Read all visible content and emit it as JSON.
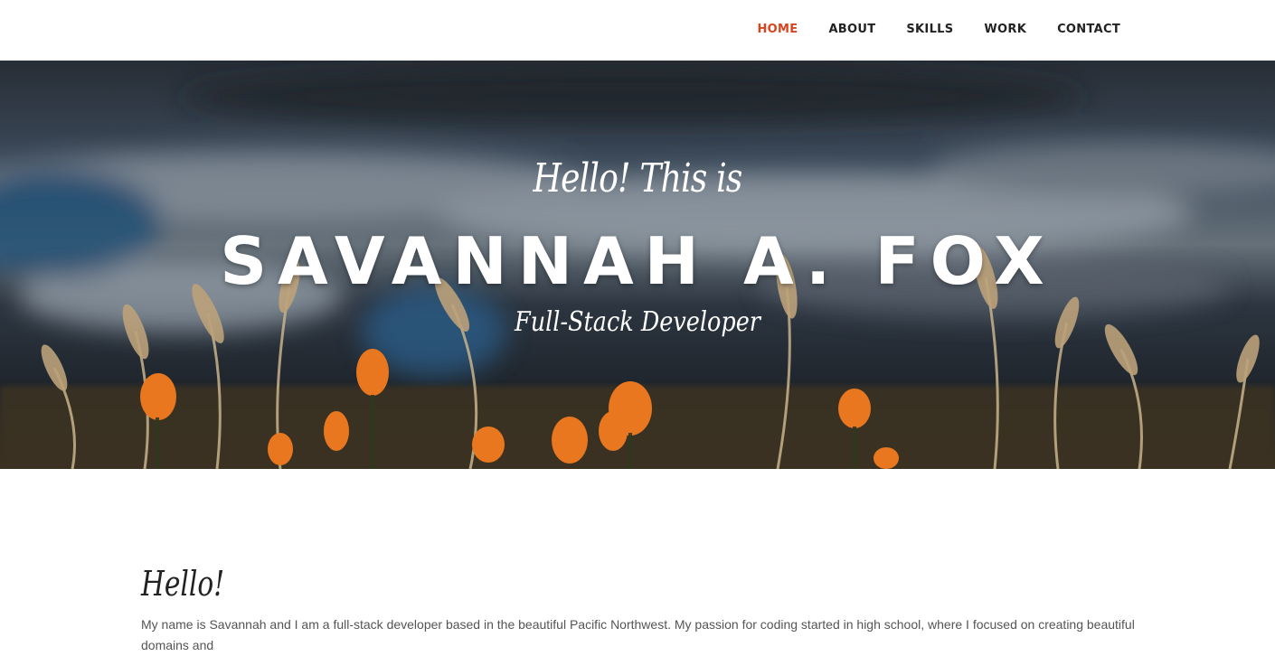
{
  "nav": {
    "items": [
      {
        "label": "HOME",
        "active": true
      },
      {
        "label": "ABOUT",
        "active": false
      },
      {
        "label": "SKILLS",
        "active": false
      },
      {
        "label": "WORK",
        "active": false
      },
      {
        "label": "CONTACT",
        "active": false
      }
    ],
    "active_color": "#d9441f"
  },
  "hero": {
    "greeting": "Hello! This is",
    "name": "SAVANNAH A. FOX",
    "role": "Full-Stack Developer"
  },
  "about": {
    "heading": "Hello!",
    "paragraph": "My name is Savannah and I am a full-stack developer based in the beautiful Pacific Northwest. My passion for coding started in high school, where I focused on creating beautiful domains and"
  }
}
